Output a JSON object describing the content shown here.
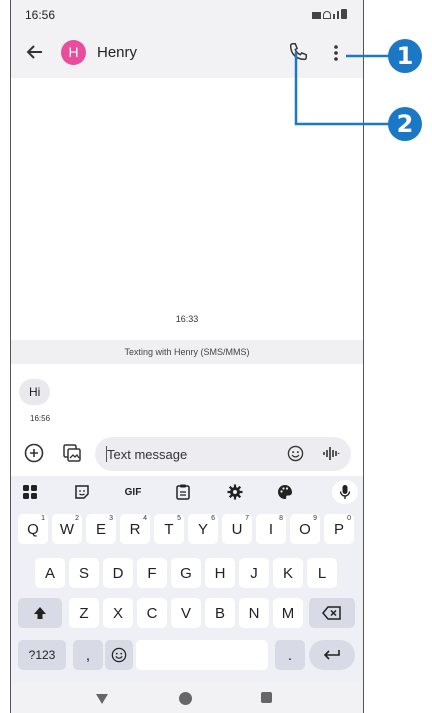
{
  "status_bar": {
    "time": "16:56"
  },
  "app_bar": {
    "back_icon": "arrow-back-icon",
    "avatar_initial": "H",
    "avatar_color": "#e94d9b",
    "contact_name": "Henry",
    "call_icon": "phone-icon",
    "more_icon": "more-vert-icon"
  },
  "conversation": {
    "time_separator": "16:33",
    "texting_banner": "Texting with Henry (SMS/MMS)",
    "messages": [
      {
        "text": "Hi",
        "time": "16:56"
      }
    ]
  },
  "composer": {
    "placeholder": "Text message"
  },
  "keyboard": {
    "toolbar": [
      "apps-icon",
      "sticker-icon",
      "GIF",
      "clipboard-icon",
      "settings-icon",
      "palette-icon",
      "mic-icon"
    ],
    "row1": [
      {
        "key": "Q",
        "hint": "1"
      },
      {
        "key": "W",
        "hint": "2"
      },
      {
        "key": "E",
        "hint": "3"
      },
      {
        "key": "R",
        "hint": "4"
      },
      {
        "key": "T",
        "hint": "5"
      },
      {
        "key": "Y",
        "hint": "6"
      },
      {
        "key": "U",
        "hint": "7"
      },
      {
        "key": "I",
        "hint": "8"
      },
      {
        "key": "O",
        "hint": "9"
      },
      {
        "key": "P",
        "hint": "0"
      }
    ],
    "row2": [
      "A",
      "S",
      "D",
      "F",
      "G",
      "H",
      "J",
      "K",
      "L"
    ],
    "row3": [
      "Z",
      "X",
      "C",
      "V",
      "B",
      "N",
      "M"
    ],
    "row4": {
      "symbols": "?123",
      "comma": ",",
      "period": "."
    }
  },
  "callouts": [
    "1",
    "2"
  ],
  "accent_color": "#1b78c4"
}
